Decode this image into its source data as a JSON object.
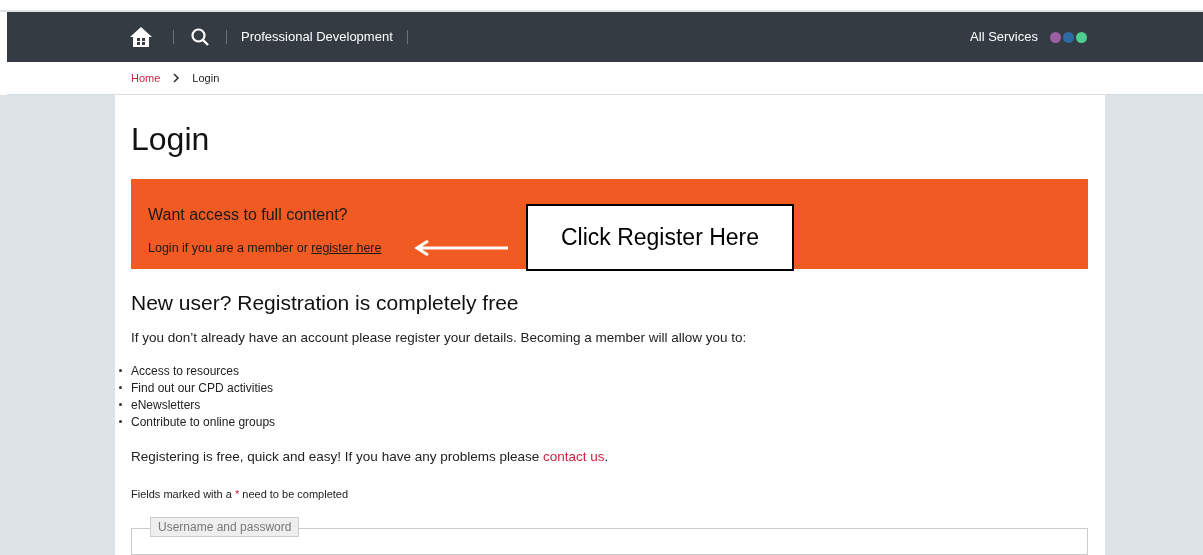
{
  "navbar": {
    "title": "Professional Development",
    "all_services": "All Services",
    "service_dots": [
      {
        "color": "#9b5fa3"
      },
      {
        "color": "#2f6aa3"
      },
      {
        "color": "#4fcf8f"
      }
    ]
  },
  "breadcrumb": [
    {
      "label": "Home",
      "link": true
    },
    {
      "label": "Login",
      "link": false
    }
  ],
  "page_title": "Login",
  "banner": {
    "heading": "Want access to full content?",
    "text": "Login if you are a member or ",
    "link": "register here"
  },
  "callout": {
    "text": "Click Register Here"
  },
  "registration": {
    "heading": "New user? Registration is completely free",
    "intro": "If you don’t already have an account please register your details. Becoming a member will allow you to:",
    "benefits": [
      "Access to resources",
      "Find out our CPD activities",
      "eNewsletters",
      "Contribute to online groups"
    ],
    "contact_text": "Registering is free, quick and easy! If you have any problems please ",
    "contact_link": "contact us",
    "contact_end": ".",
    "fields_note": {
      "before": "Fields marked with a ",
      "mark": "*",
      "after": " need to be completed"
    }
  },
  "fieldset": {
    "legend": "Username and password"
  }
}
